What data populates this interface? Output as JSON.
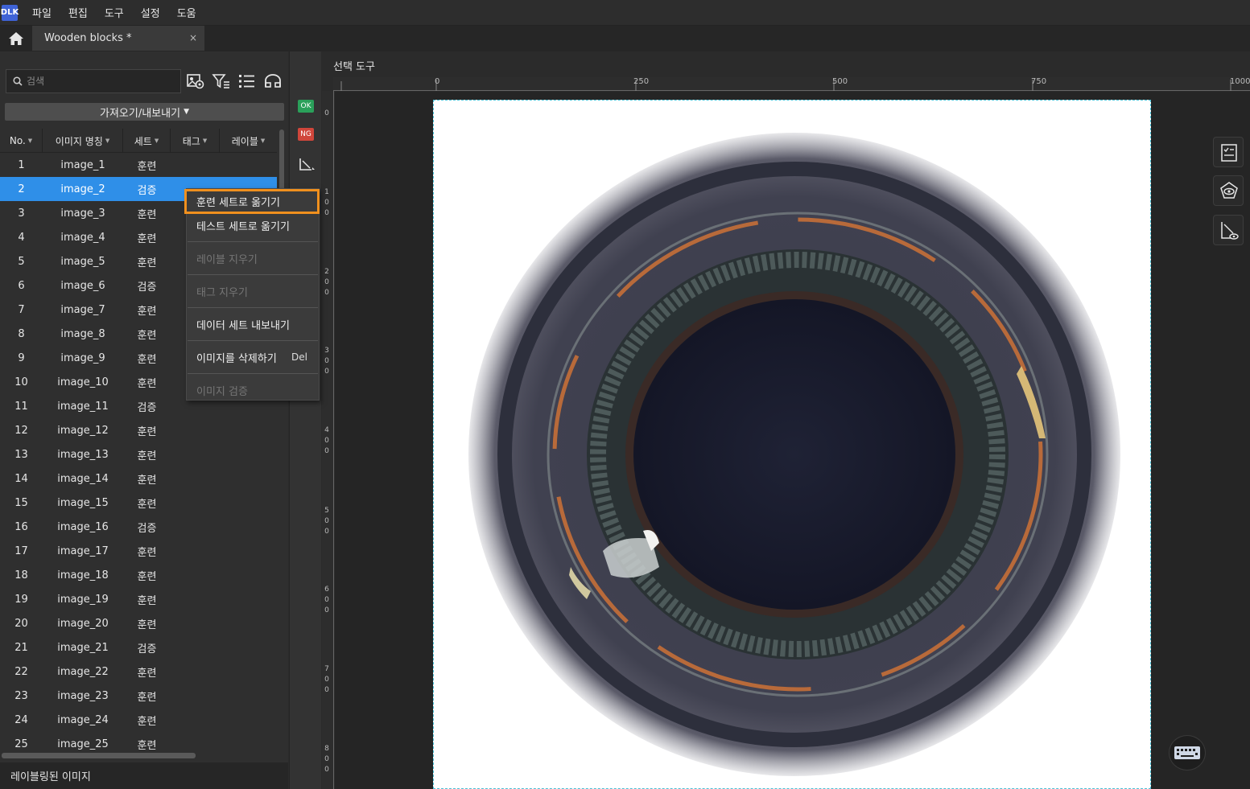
{
  "app": {
    "logo_text": "DLK"
  },
  "menu": {
    "items": [
      "파일",
      "편집",
      "도구",
      "설정",
      "도움"
    ]
  },
  "tab": {
    "title": "Wooden blocks *",
    "close": "×"
  },
  "left_panel": {
    "search_placeholder": "검색",
    "import_export_label": "가져오기/내보내기",
    "columns": [
      "No.",
      "이미지 명칭",
      "세트",
      "태그",
      "레이블"
    ],
    "rows": [
      {
        "no": "1",
        "name": "image_1",
        "set": "훈련"
      },
      {
        "no": "2",
        "name": "image_2",
        "set": "검증"
      },
      {
        "no": "3",
        "name": "image_3",
        "set": "훈련"
      },
      {
        "no": "4",
        "name": "image_4",
        "set": "훈련"
      },
      {
        "no": "5",
        "name": "image_5",
        "set": "훈련"
      },
      {
        "no": "6",
        "name": "image_6",
        "set": "검증"
      },
      {
        "no": "7",
        "name": "image_7",
        "set": "훈련"
      },
      {
        "no": "8",
        "name": "image_8",
        "set": "훈련"
      },
      {
        "no": "9",
        "name": "image_9",
        "set": "훈련"
      },
      {
        "no": "10",
        "name": "image_10",
        "set": "훈련"
      },
      {
        "no": "11",
        "name": "image_11",
        "set": "검증"
      },
      {
        "no": "12",
        "name": "image_12",
        "set": "훈련"
      },
      {
        "no": "13",
        "name": "image_13",
        "set": "훈련"
      },
      {
        "no": "14",
        "name": "image_14",
        "set": "훈련"
      },
      {
        "no": "15",
        "name": "image_15",
        "set": "훈련"
      },
      {
        "no": "16",
        "name": "image_16",
        "set": "검증"
      },
      {
        "no": "17",
        "name": "image_17",
        "set": "훈련"
      },
      {
        "no": "18",
        "name": "image_18",
        "set": "훈련"
      },
      {
        "no": "19",
        "name": "image_19",
        "set": "훈련"
      },
      {
        "no": "20",
        "name": "image_20",
        "set": "훈련"
      },
      {
        "no": "21",
        "name": "image_21",
        "set": "검증"
      },
      {
        "no": "22",
        "name": "image_22",
        "set": "훈련"
      },
      {
        "no": "23",
        "name": "image_23",
        "set": "훈련"
      },
      {
        "no": "24",
        "name": "image_24",
        "set": "훈련"
      },
      {
        "no": "25",
        "name": "image_25",
        "set": "훈련"
      }
    ],
    "selected_row_no": "2",
    "footer_label": "레이블링된 이미지"
  },
  "side_toolbar": {
    "ok_label": "OK",
    "ng_label": "NG"
  },
  "main": {
    "tool_title": "선택 도구",
    "ruler_top": [
      "0",
      "250",
      "500",
      "750",
      "1000"
    ],
    "ruler_left": [
      "0",
      "1 0 0",
      "2 0 0",
      "3 0 0",
      "4 0 0",
      "5 0 0",
      "6 0 0",
      "7 0 0",
      "8 0 0"
    ]
  },
  "context_menu": {
    "items": [
      {
        "label": "훈련 세트로 옮기기",
        "enabled": true,
        "highlighted": true
      },
      {
        "label": "테스트 세트로 옮기기",
        "enabled": true
      },
      {
        "label": "레이블 지우기",
        "enabled": false
      },
      {
        "label": "태그 지우기",
        "enabled": false
      },
      {
        "label": "데이터 세트 내보내기",
        "enabled": true
      },
      {
        "label": "이미지를 삭제하기",
        "enabled": true,
        "shortcut": "Del"
      },
      {
        "label": "이미지 검증",
        "enabled": false
      }
    ]
  },
  "colors": {
    "selection": "#2f8fe8",
    "highlight": "#f0901e",
    "ok": "#2aa05a",
    "ng": "#d0463b"
  }
}
